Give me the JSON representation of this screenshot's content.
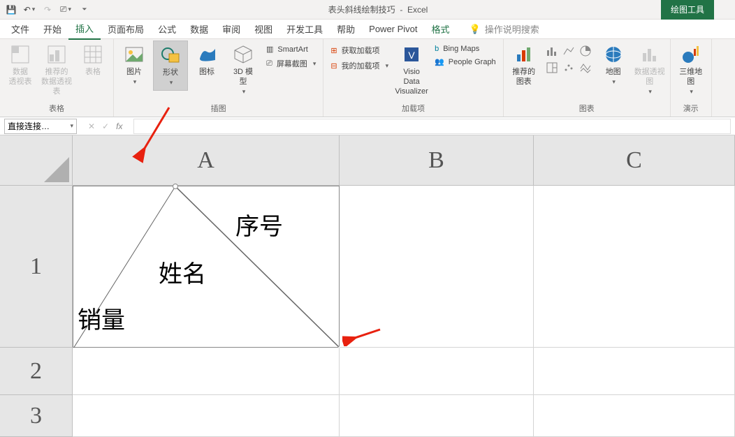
{
  "title": {
    "doc": "表头斜线绘制技巧",
    "app": "Excel",
    "context_tab": "绘图工具"
  },
  "qat": {
    "save": "💾",
    "undo": "↶",
    "redo": "↷",
    "touch": "⎚"
  },
  "tabs": {
    "file": "文件",
    "home": "开始",
    "insert": "插入",
    "layout": "页面布局",
    "formulas": "公式",
    "data": "数据",
    "review": "审阅",
    "view": "视图",
    "dev": "开发工具",
    "help": "帮助",
    "powerpivot": "Power Pivot",
    "format_ctx": "格式",
    "tell_me": "操作说明搜索"
  },
  "ribbon": {
    "tables": {
      "label": "表格",
      "pivot": "数据\n透视表",
      "rec_pivot": "推荐的\n数据透视表",
      "table": "表格"
    },
    "illus": {
      "label": "插图",
      "pictures": "图片",
      "shapes": "形状",
      "icons": "图标",
      "model3d": "3D 模\n型",
      "smartart": "SmartArt",
      "screenshot": "屏幕截图"
    },
    "addins": {
      "label": "加载项",
      "get": "获取加载项",
      "my": "我的加载项",
      "visio": "Visio Data\nVisualizer",
      "bing": "Bing Maps",
      "people": "People Graph"
    },
    "charts": {
      "label": "图表",
      "rec_chart": "推荐的\n图表",
      "map": "地图",
      "pivotchart": "数据透视图"
    },
    "tours": {
      "label": "演示",
      "map3d": "三维地\n图"
    }
  },
  "name_box": "直接连接…",
  "grid": {
    "cols": [
      "A",
      "B",
      "C"
    ],
    "rows": [
      "1",
      "2",
      "3"
    ],
    "a1": {
      "t1": "序号",
      "t2": "姓名",
      "t3": "销量"
    }
  }
}
